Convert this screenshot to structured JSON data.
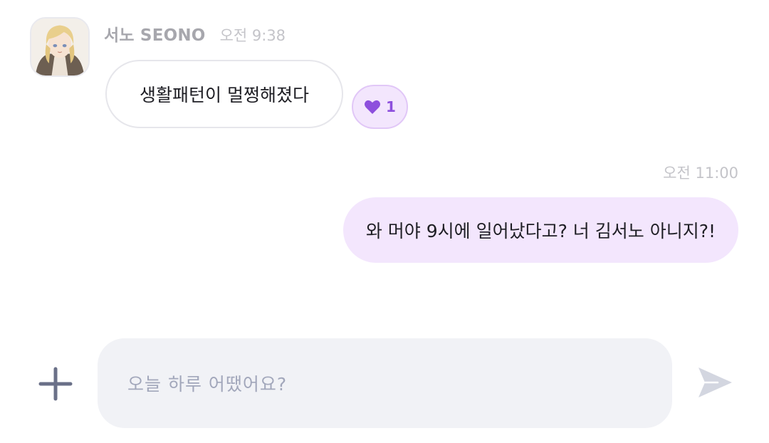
{
  "chat": {
    "incoming": {
      "sender_name": "서노 SEONO",
      "time": "오전 9:38",
      "text": "생활패턴이 멀쩡해졌다",
      "reaction": {
        "icon": "heart-icon",
        "count": "1",
        "color": "#8d4fdd"
      }
    },
    "outgoing": {
      "time": "오전 11:00",
      "text": "와 머야 9시에 일어났다고? 너 김서노 아니지?!"
    }
  },
  "composer": {
    "placeholder": "오늘 하루 어땠어요?",
    "attach_icon": "plus-icon",
    "send_icon": "send-icon"
  },
  "colors": {
    "accent": "#8d4fdd",
    "outgoing_bubble": "#f3e6fd",
    "input_background": "#f1f2f6"
  }
}
